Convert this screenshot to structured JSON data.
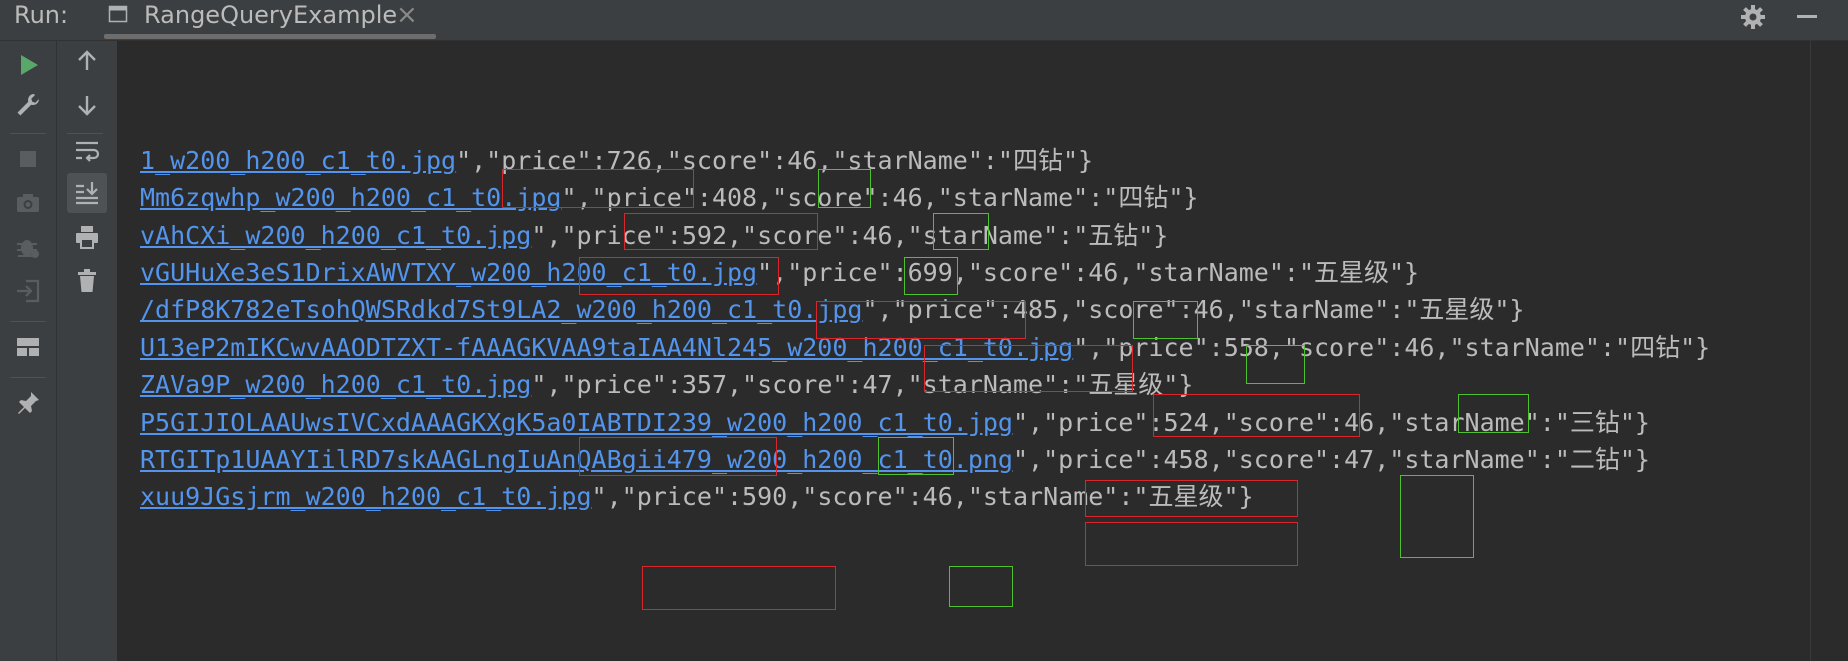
{
  "header": {
    "run_label": "Run:",
    "tab_title": "RangeQueryExample",
    "tab_close": "×"
  },
  "left_toolbar": {
    "icons": [
      "run-icon",
      "wrench-icon",
      "stop-icon",
      "camera-icon",
      "debug-icon",
      "exit-icon",
      "layout-icon",
      "pin-icon"
    ]
  },
  "second_toolbar": {
    "icons": [
      "up-arrow-icon",
      "down-arrow-icon",
      "soft-wrap-icon",
      "scroll-to-end-icon",
      "print-icon",
      "trash-icon"
    ]
  },
  "console": {
    "lines": [
      {
        "link": "1_w200_h200_c1_t0.jpg",
        "rest": "\",\"price\":726,\"score\":46,\"starName\":\"四钻\"}"
      },
      {
        "link": "Mm6zqwhp_w200_h200_c1_t0.jpg",
        "rest": "\",\"price\":408,\"score\":46,\"starName\":\"四钻\"}"
      },
      {
        "link": "vAhCXi_w200_h200_c1_t0.jpg",
        "rest": "\",\"price\":592,\"score\":46,\"starName\":\"五钻\"}"
      },
      {
        "link": "vGUHuXe3eS1DrixAWVTXY_w200_h200_c1_t0.jpg",
        "rest": "\",\"price\":699,\"score\":46,\"starName\":\"五星级\"}"
      },
      {
        "link": "/dfP8K782eTsohQWSRdkd7St9LA2_w200_h200_c1_t0.jpg",
        "rest": "\",\"price\":485,\"score\":46,\"starName\":\"五星级\"}"
      },
      {
        "link": "U13eP2mIKCwvAAODTZXT-fAAAGKVAA9taIAA4Nl245_w200_h200_c1_t0.jpg",
        "rest": "\",\"price\":558,\"score\":46,\"starName\":\"四钻\"}"
      },
      {
        "link": "ZAVa9P_w200_h200_c1_t0.jpg",
        "rest": "\",\"price\":357,\"score\":47,\"starName\":\"五星级\"}"
      },
      {
        "link": "P5GIJIOLAAUwsIVCxdAAAGKXgK5a0IABTDI239_w200_h200_c1_t0.jpg",
        "rest": "\",\"price\":524,\"score\":46,\"starName\":\"三钻\"}"
      },
      {
        "link": "RTGITp1UAAYIilRD7skAAGLngIuAnQABgii479_w200_h200_c1_t0.png",
        "rest": "\",\"price\":458,\"score\":47,\"starName\":\"二钻\"}"
      },
      {
        "link": "xuu9JGsjrm_w200_h200_c1_t0.jpg",
        "rest": "\",\"price\":590,\"score\":46,\"starName\":\"五星级\"}"
      }
    ]
  },
  "colors": {
    "background": "#2b2b2b",
    "toolbar": "#3c3f41",
    "link": "#5394ec",
    "text": "#bbbbbb",
    "highlight_red": "#d9262b",
    "highlight_green": "#4fc12f",
    "run_green": "#59a869"
  }
}
